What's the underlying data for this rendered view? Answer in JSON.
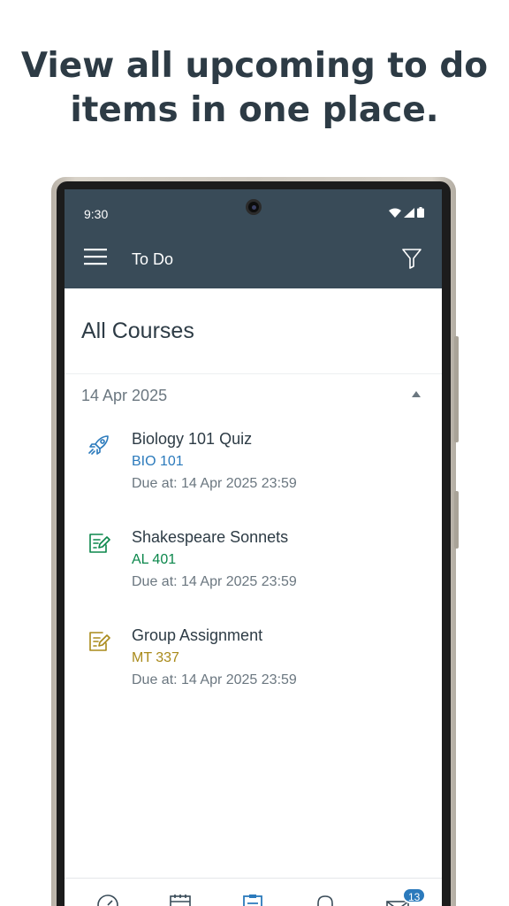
{
  "headline": {
    "line1": "View all upcoming to do",
    "line2": "items in one place."
  },
  "status_bar": {
    "time": "9:30",
    "icons": [
      "wifi-icon",
      "signal-icon",
      "battery-icon"
    ]
  },
  "app_bar": {
    "title": "To Do",
    "menu_icon": "hamburger-menu-icon",
    "filter_icon": "filter-icon",
    "color": "#394b58"
  },
  "section": {
    "title": "All Courses"
  },
  "date_group": {
    "date": "14 Apr 2025",
    "expanded": true,
    "items": [
      {
        "icon": "rocket-quiz-icon",
        "title": "Biology 101 Quiz",
        "course": "BIO 101",
        "course_color": "#2b7abc",
        "due": "Due at: 14 Apr 2025 23:59"
      },
      {
        "icon": "assignment-icon",
        "title": "Shakespeare Sonnets",
        "course": "AL 401",
        "course_color": "#0b874b",
        "due": "Due at: 14 Apr 2025 23:59"
      },
      {
        "icon": "assignment-icon",
        "title": "Group Assignment",
        "course": "MT 337",
        "course_color": "#a98a1a",
        "due": "Due at: 14 Apr 2025 23:59"
      }
    ]
  },
  "bottom_nav": {
    "items": [
      "dashboard-icon",
      "calendar-icon",
      "todo-icon",
      "notifications-icon",
      "inbox-icon"
    ],
    "inbox_badge": "13",
    "active_color": "#2b7abc"
  }
}
